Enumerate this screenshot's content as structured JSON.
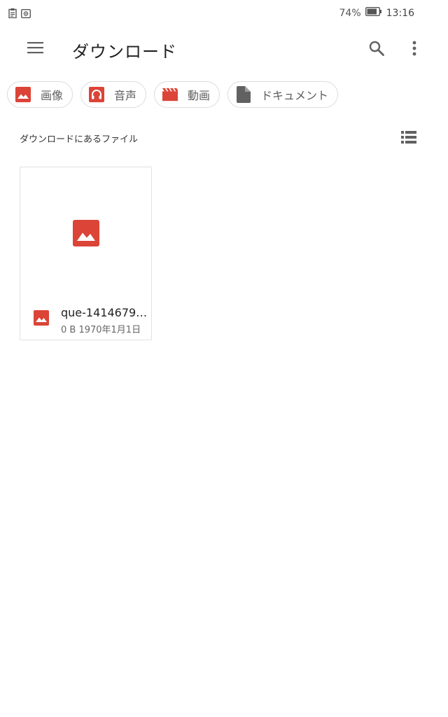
{
  "status_bar": {
    "battery_percent": "74%",
    "time": "13:16",
    "left_icons": [
      "clipboard-icon",
      "screenshot-icon"
    ]
  },
  "app_bar": {
    "title": "ダウンロード",
    "menu_icon": "hamburger-menu-icon",
    "search_icon": "search-icon",
    "more_icon": "more-vert-icon"
  },
  "chips": [
    {
      "label": "画像",
      "icon": "image-icon"
    },
    {
      "label": "音声",
      "icon": "headphones-icon"
    },
    {
      "label": "動画",
      "icon": "movie-icon"
    },
    {
      "label": "ドキュメント",
      "icon": "document-icon"
    }
  ],
  "section": {
    "title": "ダウンロードにあるファイル",
    "view_icon": "list-view-icon"
  },
  "files": [
    {
      "name": "que-14146790...",
      "info": "0 B 1970年1月1日",
      "icon": "image-icon"
    }
  ],
  "colors": {
    "accent_red": "#db4437",
    "icon_gray": "#616161",
    "chip_border": "#dcdcdc"
  }
}
